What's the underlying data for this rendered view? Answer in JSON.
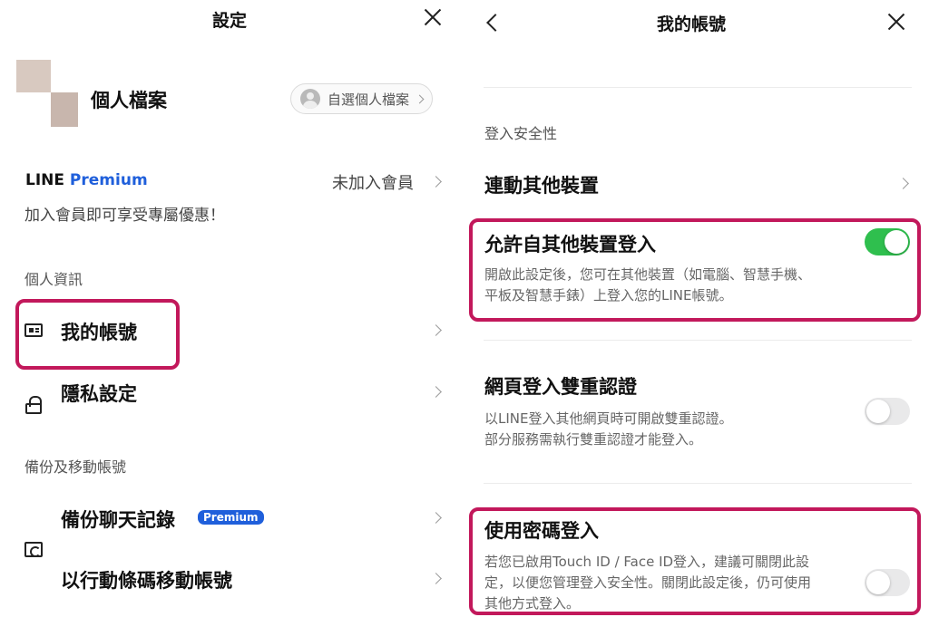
{
  "left_panel": {
    "title": "設定",
    "profile": {
      "label": "個人檔案",
      "button_label": "自選個人檔案"
    },
    "premium": {
      "brand_line": "LINE",
      "brand_premium": "Premium",
      "status": "未加入會員",
      "desc": "加入會員即可享受專屬優惠！"
    },
    "sections": {
      "personal_info": "個人資訊",
      "backup": "備份及移動帳號"
    },
    "items": {
      "my_account": "我的帳號",
      "privacy": "隱私設定",
      "backup_chat": "備份聊天記錄",
      "backup_badge": "Premium",
      "qr_move": "以行動條碼移動帳號"
    },
    "icons": [
      "close-icon",
      "card-icon",
      "lock-icon",
      "folder-icon",
      "qr-code-icon",
      "chevron-right-icon"
    ]
  },
  "right_panel": {
    "title": "我的帳號",
    "section": "登入安全性",
    "link_devices": "連動其他裝置",
    "allow_login": {
      "label": "允許自其他裝置登入",
      "desc_line1": "開啟此設定後，您可在其他裝置（如電腦、智慧手機、",
      "desc_line2": "平板及智慧手錶）上登入您的LINE帳號。",
      "enabled": true
    },
    "web_2fa": {
      "label": "網頁登入雙重認證",
      "desc_line1": "以LINE登入其他網頁時可開啟雙重認證。",
      "desc_line2": "部分服務需執行雙重認證才能登入。",
      "enabled": false
    },
    "passcode": {
      "label": "使用密碼登入",
      "desc_line1": "若您已啟用Touch ID / Face ID登入，建議可關閉此設",
      "desc_line2": "定，以便您管理登入安全性。關閉此設定後，仍可使用",
      "desc_line3": "其他方式登入。",
      "enabled": false
    },
    "icons": [
      "back-icon",
      "close-icon",
      "chevron-right-icon"
    ]
  },
  "colors": {
    "highlight": "#c2185b",
    "toggle_on": "#2fbf4e",
    "premium_blue": "#1f5fdb"
  }
}
